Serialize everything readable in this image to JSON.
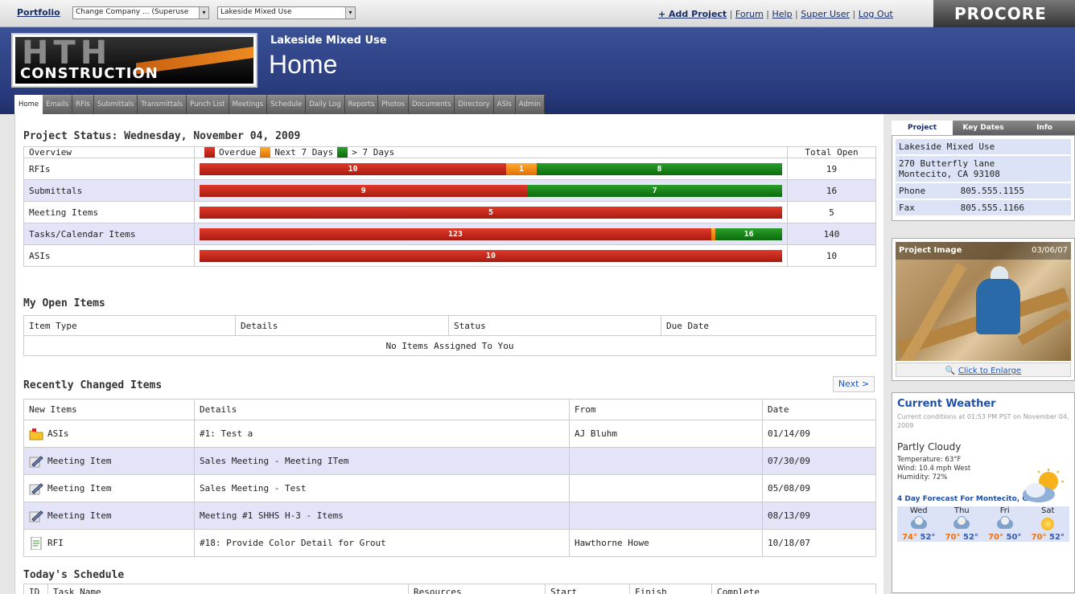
{
  "topbar": {
    "portfolio": "Portfolio",
    "company_select": "Change Company ... (Superuse",
    "project_select": "Lakeside Mixed Use",
    "links": [
      "+ Add Project",
      "Forum",
      "Help",
      "Super User",
      "Log Out"
    ],
    "brand": "PROCORE"
  },
  "header": {
    "logo_text": "HTH",
    "logo_sub": "CONSTRUCTION",
    "project_name": "Lakeside Mixed Use",
    "page_title": "Home"
  },
  "tabs": [
    "Home",
    "Emails",
    "RFIs",
    "Submittals",
    "Transmittals",
    "Punch List",
    "Meetings",
    "Schedule",
    "Daily Log",
    "Reports",
    "Photos",
    "Documents",
    "Directory",
    "ASIs",
    "Admin"
  ],
  "project_status": {
    "heading": "Project Status: Wednesday, November 04, 2009",
    "col_overview": "Overview",
    "legend": {
      "overdue": "Overdue",
      "next7": "Next 7 Days",
      "gt7": "> 7 Days"
    },
    "col_total": "Total Open",
    "colors": {
      "overdue": "#c4261a",
      "next7": "#f08a10",
      "gt7": "#1a8a1a"
    },
    "rows": [
      {
        "label": "RFIs",
        "overdue": 10,
        "next7": 1,
        "gt7": 8,
        "overdue_label": "10",
        "next7_label": "1",
        "gt7_label": "8",
        "total": "19"
      },
      {
        "label": "Submittals",
        "overdue": 9,
        "next7": 0,
        "gt7": 7,
        "overdue_label": "9",
        "next7_label": "",
        "gt7_label": "7",
        "total": "16"
      },
      {
        "label": "Meeting Items",
        "overdue": 5,
        "next7": 0,
        "gt7": 0,
        "overdue_label": "5",
        "next7_label": "",
        "gt7_label": "",
        "total": "5"
      },
      {
        "label": "Tasks/Calendar Items",
        "overdue": 123,
        "next7": 1,
        "gt7": 16,
        "overdue_label": "123",
        "next7_label": "",
        "gt7_label": "16",
        "total": "140"
      },
      {
        "label": "ASIs",
        "overdue": 10,
        "next7": 0,
        "gt7": 0,
        "overdue_label": "10",
        "next7_label": "",
        "gt7_label": "",
        "total": "10"
      }
    ]
  },
  "open_items": {
    "heading": "My Open Items",
    "columns": [
      "Item Type",
      "Details",
      "Status",
      "Due Date"
    ],
    "empty": "No Items Assigned To You"
  },
  "recent": {
    "heading": "Recently Changed Items",
    "next": "Next >",
    "columns": [
      "New Items",
      "Details",
      "From",
      "Date"
    ],
    "rows": [
      {
        "type": "ASIs",
        "icon": "folder-icon",
        "details": "#1: Test a",
        "from": "AJ Bluhm",
        "date": "01/14/09"
      },
      {
        "type": "Meeting Item",
        "icon": "meeting-pencil-icon",
        "details": "Sales Meeting - Meeting ITem",
        "from": "",
        "date": "07/30/09"
      },
      {
        "type": "Meeting Item",
        "icon": "meeting-pencil-icon",
        "details": "Sales Meeting - Test",
        "from": "",
        "date": "05/08/09"
      },
      {
        "type": "Meeting Item",
        "icon": "meeting-pencil-icon",
        "details": "Meeting #1 SHHS H-3 - Items",
        "from": "",
        "date": "08/13/09"
      },
      {
        "type": "RFI",
        "icon": "rfi-document-icon",
        "details": "#18: Provide Color Detail for Grout",
        "from": "Hawthorne Howe",
        "date": "10/18/07"
      }
    ]
  },
  "schedule": {
    "heading": "Today's Schedule",
    "columns": [
      "ID",
      "Task Name",
      "Resources",
      "Start",
      "Finish",
      "Complete"
    ]
  },
  "side": {
    "tabs": [
      "Project",
      "Key Dates",
      "Info"
    ],
    "project_name": "Lakeside Mixed Use",
    "address1": "270 Butterfly lane",
    "address2": "Montecito, CA 93108",
    "phone_label": "Phone",
    "phone": "805.555.1155",
    "fax_label": "Fax",
    "fax": "805.555.1166",
    "image_title": "Project Image",
    "image_date": "03/06/07",
    "enlarge": "Click to Enlarge",
    "weather": {
      "title": "Current Weather",
      "sub": "Current conditions at 01:53 PM PST on November 04, 2009",
      "condition": "Partly Cloudy",
      "temperature": "Temperature: 63°F",
      "wind": "Wind: 10.4 mph West",
      "humidity": "Humidity: 72%",
      "forecast_title": "4 Day Forecast For Montecito, CA",
      "days": [
        {
          "day": "Wed",
          "hi": "74°",
          "lo": "52°",
          "icon": "cloud"
        },
        {
          "day": "Thu",
          "hi": "70°",
          "lo": "52°",
          "icon": "cloud"
        },
        {
          "day": "Fri",
          "hi": "70°",
          "lo": "50°",
          "icon": "cloud"
        },
        {
          "day": "Sat",
          "hi": "70°",
          "lo": "52°",
          "icon": "sun"
        }
      ]
    }
  }
}
